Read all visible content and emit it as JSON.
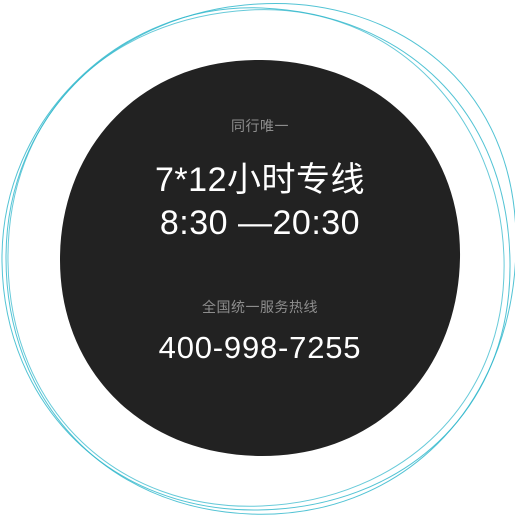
{
  "badge": {
    "tagline": "同行唯一",
    "hours_title": "7*12小时专线",
    "hours_range": "8:30 —20:30",
    "hotline_label": "全国统一服务热线",
    "phone": "400-998-7255"
  },
  "colors": {
    "disc": "#222222",
    "ring": "#34b8cc",
    "muted_text": "#8d8d8d",
    "main_text": "#ffffff"
  }
}
